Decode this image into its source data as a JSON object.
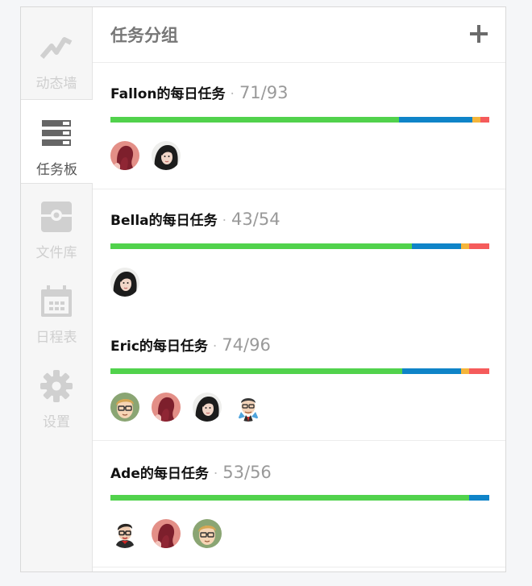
{
  "sidebar": {
    "items": [
      {
        "label": "动态墙",
        "icon": "activity-chart-icon",
        "active": false
      },
      {
        "label": "任务板",
        "icon": "task-board-icon",
        "active": true
      },
      {
        "label": "文件库",
        "icon": "file-library-icon",
        "active": false
      },
      {
        "label": "日程表",
        "icon": "calendar-icon",
        "active": false
      },
      {
        "label": "设置",
        "icon": "gear-icon",
        "active": false
      }
    ]
  },
  "header": {
    "title": "任务分组",
    "add_icon": "plus-icon"
  },
  "groups": [
    {
      "name": "Fallon的每日任务",
      "separator": "·",
      "count": "71/93",
      "progress": {
        "green": 0.762,
        "blue": 0.193,
        "yellow": 0.021,
        "red": 0.024
      },
      "avatars": [
        "avatar-red-hair",
        "avatar-black-hair-girl"
      ]
    },
    {
      "name": "Bella的每日任务",
      "separator": "·",
      "count": "43/54",
      "progress": {
        "green": 0.796,
        "blue": 0.13,
        "yellow": 0.021,
        "red": 0.053
      },
      "avatars": [
        "avatar-black-hair-girl"
      ]
    },
    {
      "name": "Eric的每日任务",
      "separator": "·",
      "count": "74/96",
      "progress": {
        "green": 0.771,
        "blue": 0.155,
        "yellow": 0.021,
        "red": 0.053
      },
      "avatars": [
        "avatar-glasses-blond",
        "avatar-red-hair",
        "avatar-black-hair-girl",
        "avatar-business-man"
      ]
    },
    {
      "name": "Ade的每日任务",
      "separator": "·",
      "count": "53/56",
      "progress": {
        "green": 0.947,
        "blue": 0.053,
        "yellow": 0,
        "red": 0
      },
      "avatars": [
        "avatar-dark-hair-glasses",
        "avatar-red-hair",
        "avatar-glasses-blond"
      ]
    }
  ],
  "colors": {
    "green": "#51d24c",
    "blue": "#0f84c8",
    "yellow": "#f5b53a",
    "red": "#f55b5b"
  }
}
